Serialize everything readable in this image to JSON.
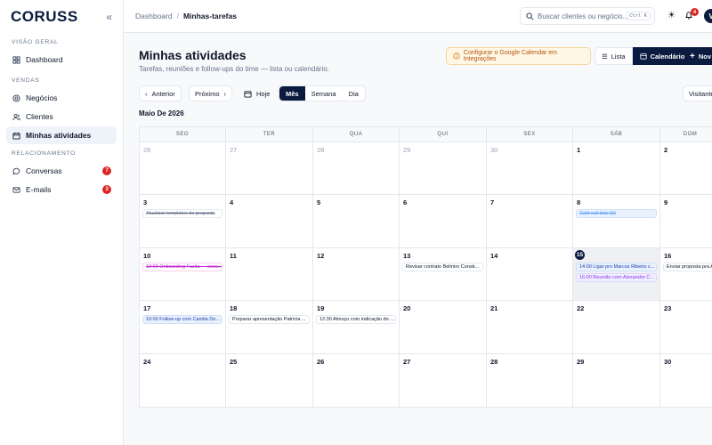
{
  "app": {
    "logo": "CORUSS",
    "collapse_icon": "«"
  },
  "sidebar": {
    "sections": [
      {
        "label": "VISÃO GERAL",
        "items": [
          {
            "label": "Dashboard",
            "icon": "grid-icon"
          }
        ]
      },
      {
        "label": "VENDAS",
        "items": [
          {
            "label": "Negócios",
            "icon": "target-icon"
          },
          {
            "label": "Clientes",
            "icon": "users-icon"
          },
          {
            "label": "Minhas atividades",
            "icon": "calendar-icon",
            "active": true
          }
        ]
      },
      {
        "label": "RELACIONAMENTO",
        "items": [
          {
            "label": "Conversas",
            "icon": "chat-icon",
            "badge": "7"
          },
          {
            "label": "E-mails",
            "icon": "mail-icon",
            "badge": "3"
          }
        ]
      }
    ]
  },
  "topbar": {
    "breadcrumb": [
      "Dashboard",
      "Minhas-tarefas"
    ],
    "search_placeholder": "Buscar clientes ou negócio...",
    "search_shortcut": "Ctrl K",
    "notif_count": "4",
    "avatar_initial": "V"
  },
  "page": {
    "title": "Minhas atividades",
    "subtitle": "Tarefas, reuniões e follow-ups do time — lista ou calendário.",
    "gcal_notice": "Configurar o Google Calendar em Integrações",
    "view_list": "Lista",
    "view_calendar": "Calendário",
    "new_button": "Nov",
    "prev": "Anterior",
    "next": "Próximo",
    "today": "Hoje",
    "modes": [
      "Mês",
      "Semana",
      "Dia"
    ],
    "visitor_filter": "Visitante",
    "month_label": "Maio De 2026"
  },
  "calendar": {
    "weekdays": [
      "SEG",
      "TER",
      "QUA",
      "QUI",
      "SEX",
      "SÁB",
      "DOM"
    ],
    "weeks": [
      [
        {
          "d": "26",
          "m": true
        },
        {
          "d": "27",
          "m": true
        },
        {
          "d": "28",
          "m": true
        },
        {
          "d": "29",
          "m": true
        },
        {
          "d": "30",
          "m": true
        },
        {
          "d": "1"
        },
        {
          "d": "2"
        }
      ],
      [
        {
          "d": "3",
          "ev": [
            {
              "t": "Atualizar templates de proposta",
              "s": "done"
            }
          ]
        },
        {
          "d": "4"
        },
        {
          "d": "5"
        },
        {
          "d": "6"
        },
        {
          "d": "7"
        },
        {
          "d": "8",
          "ev": [
            {
              "t": "Cold call lista Q1",
              "s": "blue done"
            }
          ]
        },
        {
          "d": "9"
        }
      ],
      [
        {
          "d": "10",
          "ev": [
            {
              "t": "10:00 Onboarding Fazita — sess...",
              "s": "pink"
            }
          ]
        },
        {
          "d": "11"
        },
        {
          "d": "12"
        },
        {
          "d": "13",
          "ev": [
            {
              "t": "Revisar contrato Belmiro Constr...",
              "s": ""
            }
          ]
        },
        {
          "d": "14"
        },
        {
          "d": "15",
          "today": true,
          "ev": [
            {
              "t": "14:00 Ligar pro Marcos Ribeiro c...",
              "s": "blue"
            },
            {
              "t": "16:00 Reunião com Alexandre C...",
              "s": "purple"
            }
          ]
        },
        {
          "d": "16",
          "ev": [
            {
              "t": "Enviar proposta pra A...",
              "s": ""
            }
          ]
        }
      ],
      [
        {
          "d": "17",
          "ev": [
            {
              "t": "10:00 Follow-up com Camila Do...",
              "s": "blue"
            }
          ]
        },
        {
          "d": "18",
          "ev": [
            {
              "t": "Preparar apresentação Patrícia ...",
              "s": ""
            }
          ]
        },
        {
          "d": "19",
          "ev": [
            {
              "t": "12:30 Almoço com indicação do ...",
              "s": ""
            }
          ]
        },
        {
          "d": "20"
        },
        {
          "d": "21"
        },
        {
          "d": "22"
        },
        {
          "d": "23"
        }
      ],
      [
        {
          "d": "24"
        },
        {
          "d": "25"
        },
        {
          "d": "26"
        },
        {
          "d": "27"
        },
        {
          "d": "28"
        },
        {
          "d": "29"
        },
        {
          "d": "30"
        }
      ]
    ]
  }
}
